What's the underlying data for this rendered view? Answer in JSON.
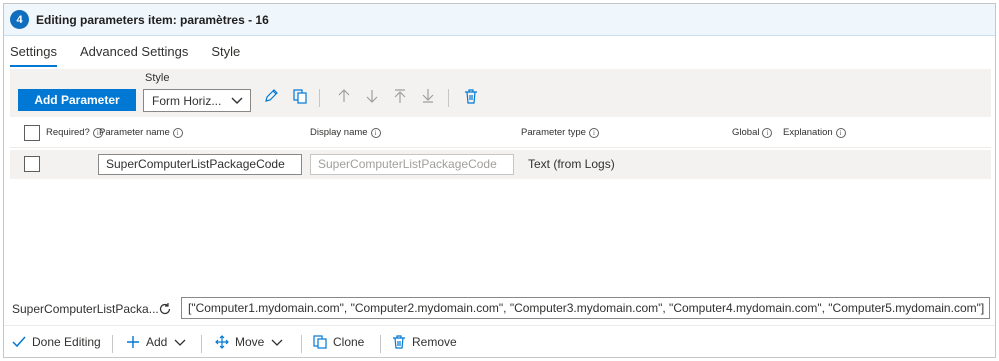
{
  "header": {
    "step": "4",
    "title": "Editing parameters item: paramètres - 16"
  },
  "tabs": [
    {
      "label": "Settings",
      "active": true
    },
    {
      "label": "Advanced Settings",
      "active": false
    },
    {
      "label": "Style",
      "active": false
    }
  ],
  "toolbar": {
    "add_parameter_label": "Add Parameter",
    "style_label": "Style",
    "style_value": "Form Horiz...",
    "icons": [
      "edit-icon",
      "copy-icon",
      "move-up-icon",
      "move-down-icon",
      "move-top-icon",
      "move-bottom-icon",
      "delete-icon"
    ]
  },
  "grid": {
    "columns": {
      "required": "Required?",
      "name": "Parameter name",
      "display": "Display name",
      "type": "Parameter type",
      "global": "Global",
      "explanation": "Explanation"
    },
    "rows": [
      {
        "name": "SuperComputerListPackageCode",
        "display_placeholder": "SuperComputerListPackageCode",
        "type": "Text (from Logs)"
      }
    ]
  },
  "preview": {
    "label": "SuperComputerListPacka...",
    "value": "[\"Computer1.mydomain.com\", \"Computer2.mydomain.com\", \"Computer3.mydomain.com\", \"Computer4.mydomain.com\", \"Computer5.mydomain.com\"]"
  },
  "footer": {
    "done_label": "Done Editing",
    "add_label": "Add",
    "move_label": "Move",
    "clone_label": "Clone",
    "remove_label": "Remove"
  },
  "colors": {
    "accent": "#0078d4",
    "header_bg": "#eff6fc",
    "row_bg": "#f3f2f1"
  }
}
